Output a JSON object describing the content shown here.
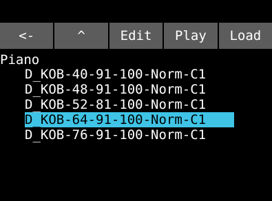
{
  "toolbar": {
    "back_label": "<-",
    "up_label": "^",
    "edit_label": "Edit",
    "play_label": "Play",
    "load_label": "Load"
  },
  "browser": {
    "folder_name": "Piano",
    "files": [
      "D_KOB-40-91-100-Norm-C1",
      "D_KOB-48-91-100-Norm-C1",
      "D_KOB-52-81-100-Norm-C1",
      "D_KOB-64-91-100-Norm-C1",
      "D_KOB-76-91-100-Norm-C1"
    ],
    "selected_file": "D_KOB-64-91-100-Norm-C1"
  },
  "colors": {
    "background": "#000000",
    "button": "#5c5c5c",
    "selection": "#3fc4e6",
    "text": "#ffffff"
  }
}
